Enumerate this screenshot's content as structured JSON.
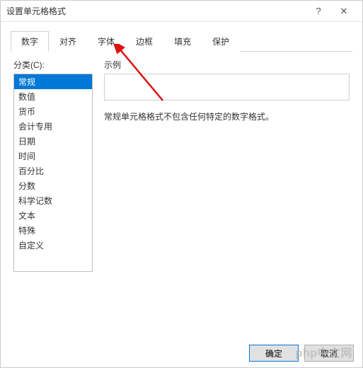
{
  "titlebar": {
    "title": "设置单元格格式",
    "help": "?",
    "close": "✕"
  },
  "tabs": [
    {
      "label": "数字",
      "active": true
    },
    {
      "label": "对齐",
      "active": false
    },
    {
      "label": "字体",
      "active": false
    },
    {
      "label": "边框",
      "active": false
    },
    {
      "label": "填充",
      "active": false
    },
    {
      "label": "保护",
      "active": false
    }
  ],
  "category": {
    "label": "分类(C):",
    "items": [
      {
        "label": "常规",
        "selected": true
      },
      {
        "label": "数值",
        "selected": false
      },
      {
        "label": "货币",
        "selected": false
      },
      {
        "label": "会计专用",
        "selected": false
      },
      {
        "label": "日期",
        "selected": false
      },
      {
        "label": "时间",
        "selected": false
      },
      {
        "label": "百分比",
        "selected": false
      },
      {
        "label": "分数",
        "selected": false
      },
      {
        "label": "科学记数",
        "selected": false
      },
      {
        "label": "文本",
        "selected": false
      },
      {
        "label": "特殊",
        "selected": false
      },
      {
        "label": "自定义",
        "selected": false
      }
    ]
  },
  "sample": {
    "label": "示例"
  },
  "description": "常规单元格格式不包含任何特定的数字格式。",
  "buttons": {
    "ok": "确定",
    "cancel": "取消"
  },
  "watermark": "php中文网",
  "chart_data": null
}
